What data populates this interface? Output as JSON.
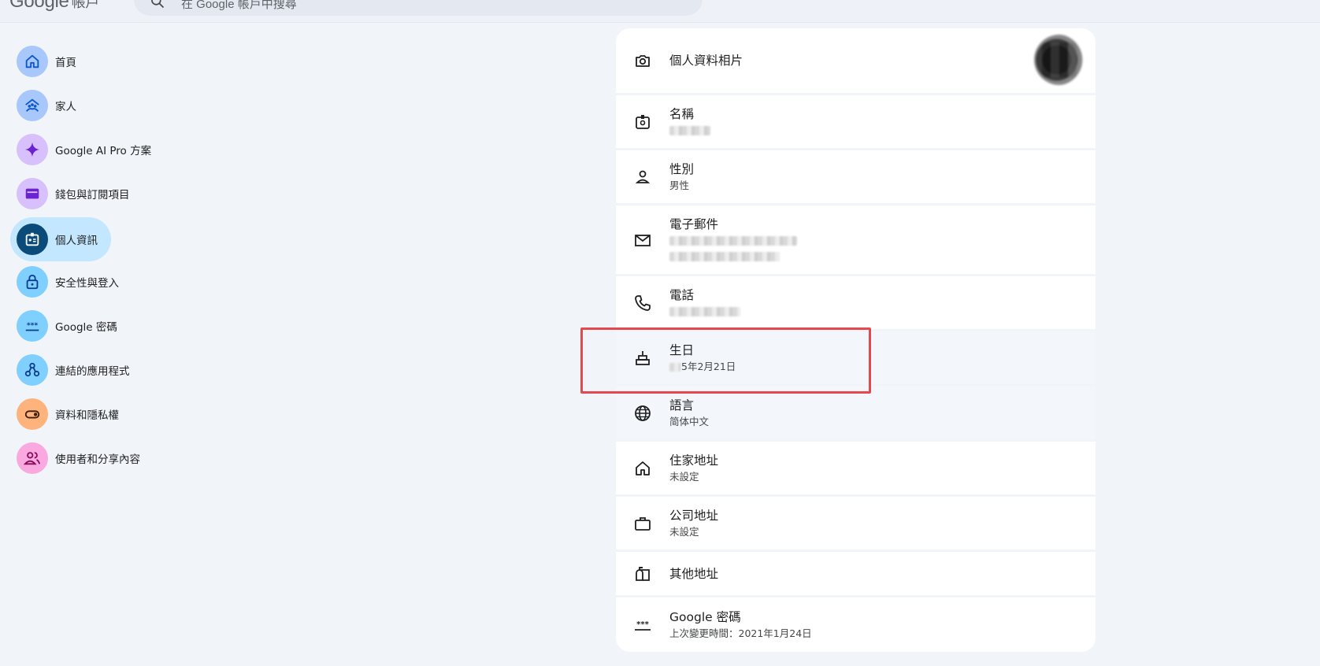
{
  "header": {
    "brand": "Google",
    "brand_sub": "帳戶",
    "search_placeholder": "在 Google 帳戶中搜尋"
  },
  "sidebar": {
    "items": [
      {
        "label": "首頁",
        "icon": "home-icon",
        "bg": "#a8c7fa",
        "fg": "#0b57d0"
      },
      {
        "label": "家人",
        "icon": "family-icon",
        "bg": "#a8c7fa",
        "fg": "#0b57d0"
      },
      {
        "label": "Google AI Pro 方案",
        "icon": "sparkle-icon",
        "bg": "#d7c0fb",
        "fg": "#6b21d4"
      },
      {
        "label": "錢包與訂閱項目",
        "icon": "wallet-icon",
        "bg": "#d7c0fb",
        "fg": "#6b21d4"
      },
      {
        "label": "個人資訊",
        "icon": "id-badge-icon",
        "bg": "#0b4b7a",
        "fg": "#ffffff",
        "active": true
      },
      {
        "label": "安全性與登入",
        "icon": "lock-icon",
        "bg": "#7fcfff",
        "fg": "#0b3d91"
      },
      {
        "label": "Google 密碼",
        "icon": "password-icon",
        "bg": "#7fcfff",
        "fg": "#0b3d91"
      },
      {
        "label": "連結的應用程式",
        "icon": "apps-link-icon",
        "bg": "#7fcfff",
        "fg": "#0b3d91"
      },
      {
        "label": "資料和隱私權",
        "icon": "toggle-icon",
        "bg": "#ffb37c",
        "fg": "#3b1f0a"
      },
      {
        "label": "使用者和分享內容",
        "icon": "people-icon",
        "bg": "#f9a8e0",
        "fg": "#8a0d5e"
      }
    ]
  },
  "card": {
    "rows": [
      {
        "title": "個人資料相片",
        "icon": "camera-icon"
      },
      {
        "title": "名稱",
        "icon": "name-badge-icon"
      },
      {
        "title": "性別",
        "value": "男性",
        "icon": "person-icon"
      },
      {
        "title": "電子郵件",
        "icon": "mail-icon"
      },
      {
        "title": "電話",
        "icon": "phone-icon"
      },
      {
        "title": "生日",
        "value": "5年2月21日",
        "icon": "cake-icon"
      },
      {
        "title": "語言",
        "value": "简体中文",
        "icon": "globe-icon"
      },
      {
        "title": "住家地址",
        "value": "未設定",
        "icon": "home-icon"
      },
      {
        "title": "公司地址",
        "value": "未設定",
        "icon": "briefcase-icon"
      },
      {
        "title": "其他地址",
        "icon": "mailbox-icon"
      },
      {
        "title": "Google 密碼",
        "value": "上次變更時間：2021年1月24日",
        "icon": "password-icon"
      }
    ]
  },
  "colors": {
    "highlight_box": "#e5484d",
    "page_bg": "#f1f4f9",
    "active_nav": "#c2e7ff"
  }
}
